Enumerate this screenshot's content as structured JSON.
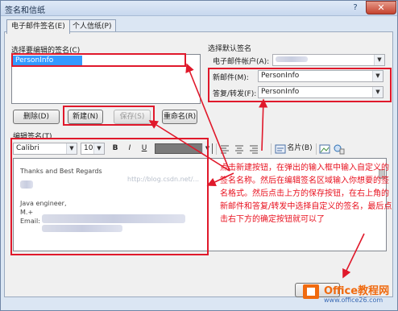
{
  "window": {
    "title": "签名和信纸",
    "help_glyph": "?",
    "close_glyph": "✕"
  },
  "tabs": [
    {
      "label": "电子邮件签名(E)"
    },
    {
      "label": "个人信纸(P)"
    }
  ],
  "select_signature": {
    "label": "选择要编辑的签名(C)",
    "items": [
      "PersonInfo"
    ]
  },
  "defaults": {
    "heading": "选择默认签名",
    "account_label": "电子邮件帐户(A):",
    "new_messages_label": "新邮件(M):",
    "new_messages_value": "PersonInfo",
    "replies_label": "答复/转发(F):",
    "replies_value": "PersonInfo"
  },
  "buttons": {
    "delete": "删除(D)",
    "new": "新建(N)",
    "save": "保存(S)",
    "rename": "重命名(R)"
  },
  "edit_section": {
    "label": "编辑签名(T)"
  },
  "toolbar": {
    "font": "Calibri",
    "size": "10",
    "bold": "B",
    "italic": "I",
    "underline": "U",
    "business_card": "名片(B)"
  },
  "editor_text": {
    "line1": "Thanks and Best Regards",
    "line2": "Java engineer,",
    "line3": "M.+",
    "line4": "Email:",
    "watermark": "http://blog.csdn.net/..."
  },
  "annotation": "点击新建按钮，在弹出的输入框中输入自定义的签名名称。然后在编辑签名区域输入你想要的签名格式。然后点击上方的保存按钮，在右上角的新邮件和答复/转发中选择自定义的签名，最后点击右下方的确定按钮就可以了",
  "logo": {
    "brand": "Office教程网",
    "url": "www.office26.com"
  },
  "colors": {
    "annotation_red": "#e0192b",
    "selection_blue": "#3399ff",
    "logo_orange": "#f06a0f"
  }
}
